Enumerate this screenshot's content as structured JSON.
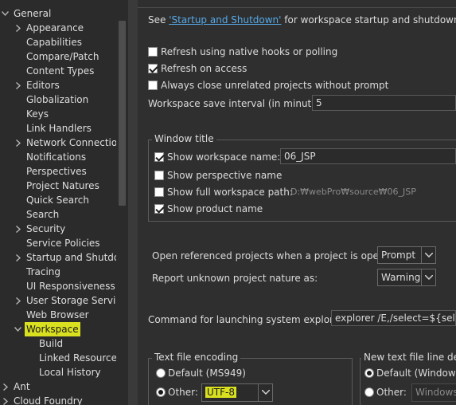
{
  "tree": {
    "items": [
      {
        "label": "General",
        "level": 0,
        "twisty": "down"
      },
      {
        "label": "Appearance",
        "level": 1,
        "twisty": "right"
      },
      {
        "label": "Capabilities",
        "level": 1,
        "twisty": ""
      },
      {
        "label": "Compare/Patch",
        "level": 1,
        "twisty": ""
      },
      {
        "label": "Content Types",
        "level": 1,
        "twisty": ""
      },
      {
        "label": "Editors",
        "level": 1,
        "twisty": "right"
      },
      {
        "label": "Globalization",
        "level": 1,
        "twisty": ""
      },
      {
        "label": "Keys",
        "level": 1,
        "twisty": ""
      },
      {
        "label": "Link Handlers",
        "level": 1,
        "twisty": ""
      },
      {
        "label": "Network Connections",
        "level": 1,
        "twisty": "right"
      },
      {
        "label": "Notifications",
        "level": 1,
        "twisty": ""
      },
      {
        "label": "Perspectives",
        "level": 1,
        "twisty": ""
      },
      {
        "label": "Project Natures",
        "level": 1,
        "twisty": ""
      },
      {
        "label": "Quick Search",
        "level": 1,
        "twisty": ""
      },
      {
        "label": "Search",
        "level": 1,
        "twisty": ""
      },
      {
        "label": "Security",
        "level": 1,
        "twisty": "right"
      },
      {
        "label": "Service Policies",
        "level": 1,
        "twisty": ""
      },
      {
        "label": "Startup and Shutdown",
        "level": 1,
        "twisty": "right"
      },
      {
        "label": "Tracing",
        "level": 1,
        "twisty": ""
      },
      {
        "label": "UI Responsiveness Monitoring",
        "level": 1,
        "twisty": ""
      },
      {
        "label": "User Storage Service",
        "level": 1,
        "twisty": "right"
      },
      {
        "label": "Web Browser",
        "level": 1,
        "twisty": ""
      },
      {
        "label": "Workspace",
        "level": 1,
        "twisty": "down",
        "highlight": true
      },
      {
        "label": "Build",
        "level": 2,
        "twisty": ""
      },
      {
        "label": "Linked Resources",
        "level": 2,
        "twisty": ""
      },
      {
        "label": "Local History",
        "level": 2,
        "twisty": ""
      },
      {
        "label": "Ant",
        "level": 0,
        "twisty": "right"
      },
      {
        "label": "Cloud Foundry",
        "level": 0,
        "twisty": "right"
      }
    ]
  },
  "workspace": {
    "see_prefix": "See ",
    "see_link": "'Startup and Shutdown'",
    "see_suffix": " for workspace startup and shutdown preferences.",
    "refresh_native_label": "Refresh using native hooks or polling",
    "refresh_native_checked": false,
    "refresh_access_label": "Refresh on access",
    "refresh_access_checked": true,
    "always_close_label": "Always close unrelated projects without prompt",
    "always_close_checked": false,
    "save_interval_label": "Workspace save interval (in minutes):",
    "save_interval_value": "5",
    "window_title": {
      "group_label": "Window title",
      "show_name_label": "Show workspace name:",
      "show_name_checked": true,
      "name_value": "06_JSP",
      "show_perspective_label": "Show perspective name",
      "show_perspective_checked": false,
      "show_path_label": "Show full workspace path:",
      "show_path_checked": false,
      "path_value": "D:₩webPro₩source₩06_JSP",
      "show_product_label": "Show product name",
      "show_product_checked": true
    },
    "open_ref_label": "Open referenced projects when a project is opened:",
    "open_ref_value": "Prompt",
    "report_unknown_label": "Report unknown project nature as:",
    "report_unknown_value": "Warning",
    "command_label": "Command for launching system explorer:",
    "command_value": "explorer /E,/select=${selected_resource_loc}",
    "encoding": {
      "group_label": "Text file encoding",
      "default_label": "Default (MS949)",
      "default_selected": false,
      "other_label": "Other:",
      "other_selected": true,
      "other_value": "UTF-8"
    },
    "line_delim": {
      "group_label": "New text file line delimiter",
      "default_label": "Default (Windows)",
      "default_selected": true,
      "other_label": "Other:",
      "other_selected": false,
      "other_value": "Windows"
    }
  },
  "colors": {
    "highlight": "#d9e020",
    "link": "#55a9e8",
    "background": "#2f2f2f"
  }
}
